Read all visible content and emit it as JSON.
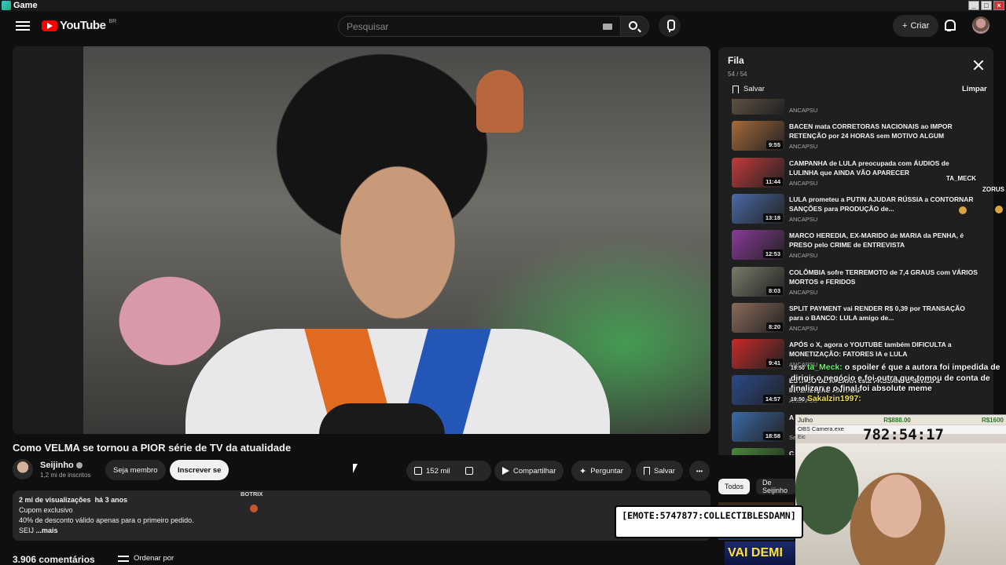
{
  "window": {
    "title": "Game"
  },
  "header": {
    "logo_text": "YouTube",
    "logo_region": "BR",
    "search_placeholder": "Pesquisar",
    "create_label": "Criar"
  },
  "video": {
    "title": "Como VELMA se tornou a PIOR série de TV da atualidade",
    "channel_name": "Seijinho",
    "subscribers": "1,2 mi de inscritos",
    "join_label": "Seja membro",
    "subscribe_label": "Inscrever se",
    "likes": "152 mil",
    "share_label": "Compartilhar",
    "ask_label": "Perguntar",
    "save_label": "Salvar",
    "more_label": "•••",
    "views": "2 mi de visualizações",
    "age": "há 3 anos",
    "desc_line1": "Cupom exclusivo",
    "desc_line2": "40% de desconto válido apenas para o primeiro pedido.",
    "desc_line3_prefix": "SEIJ",
    "desc_more": "...mais",
    "comments_count": "3.906 comentários",
    "order_by": "Ordenar por"
  },
  "queue": {
    "title": "Fila",
    "count": "54 / 54",
    "save_label": "Salvar",
    "clear_label": "Limpar",
    "items": [
      {
        "title": "",
        "channel": "ANCAPSU",
        "duration": "",
        "color": "#6a5a4a"
      },
      {
        "title": "BACEN mata CORRETORAS NACIONAIS ao IMPOR RETENÇÃO por 24 HORAS sem MOTIVO ALGUM",
        "channel": "ANCAPSU",
        "duration": "9:55",
        "color": "#a66a3a"
      },
      {
        "title": "CAMPANHA de LULA preocupada com ÁUDIOS de LULINHA que AINDA VÃO APARECER",
        "channel": "ANCAPSU",
        "duration": "11:44",
        "color": "#c23a3a"
      },
      {
        "title": "LULA prometeu a PUTIN AJUDAR RÚSSIA a CONTORNAR SANÇÕES para PRODUÇÃO de...",
        "channel": "ANCAPSU",
        "duration": "13:18",
        "color": "#4a6aa8"
      },
      {
        "title": "MARCO HEREDIA, EX-MARIDO de MARIA da PENHA, é PRESO pelo CRIME de ENTREVISTA",
        "channel": "ANCAPSU",
        "duration": "12:53",
        "color": "#8a3a9a"
      },
      {
        "title": "COLÔMBIA sofre TERREMOTO de 7,4 GRAUS com VÁRIOS MORTOS e FERIDOS",
        "channel": "ANCAPSU",
        "duration": "8:03",
        "color": "#7a7a6a"
      },
      {
        "title": "SPLIT PAYMENT vai RENDER R$ 0,39 por TRANSAÇÃO para o BANCO: LULA amigo de...",
        "channel": "ANCAPSU",
        "duration": "8:20",
        "color": "#8a6a5a"
      },
      {
        "title": "APÓS o X, agora o YOUTUBE também DIFICULTA a MONETIZAÇÃO: FATORES IA e LULA",
        "channel": "ANCAPSU",
        "duration": "9:41",
        "color": "#c82a2a"
      },
      {
        "title": "ESTADO DE ATERRA está PASSANDO devido a INTERDIÇÃO ANTI-OS",
        "channel": "ANCAPSU",
        "duration": "14:57",
        "color": "#2a4a8a"
      },
      {
        "title": "A Garota Invisível desafia a Lei da Sobrevivência",
        "channel": "Se",
        "duration": "18:58",
        "color": "#3a6aa8"
      },
      {
        "title": "C",
        "channel": "Se",
        "duration": "28:38",
        "color": "#4a8a3a"
      }
    ]
  },
  "chips": {
    "all": "Todos",
    "from": "De Seijinho"
  },
  "overlay": {
    "tamech": "TA_MECK",
    "zorus": "ZORUS",
    "botrix": "BOTRIX",
    "chat1_time": "19:50",
    "chat1_user": "ta_Meck:",
    "chat1_text": "o spoiler é que a autora foi impedida de dirigir o negócio e foi outra que tomou de conta de finalizar, e o final foi absolute meme",
    "chat2_time": "19:50",
    "chat2_user": "Sakalzin1997:",
    "emote_text": "[EMOTE:5747877:COLLECTIBLESDAMN]"
  },
  "cam": {
    "bar_left": "Julho",
    "bar_mid": "R$888.00",
    "bar_right": "R$1600",
    "sub_label": "OBS Camera.exe",
    "timer": "782:54:17",
    "eic": "Eic"
  },
  "bottom_thumb_text": "VAI DEMI"
}
